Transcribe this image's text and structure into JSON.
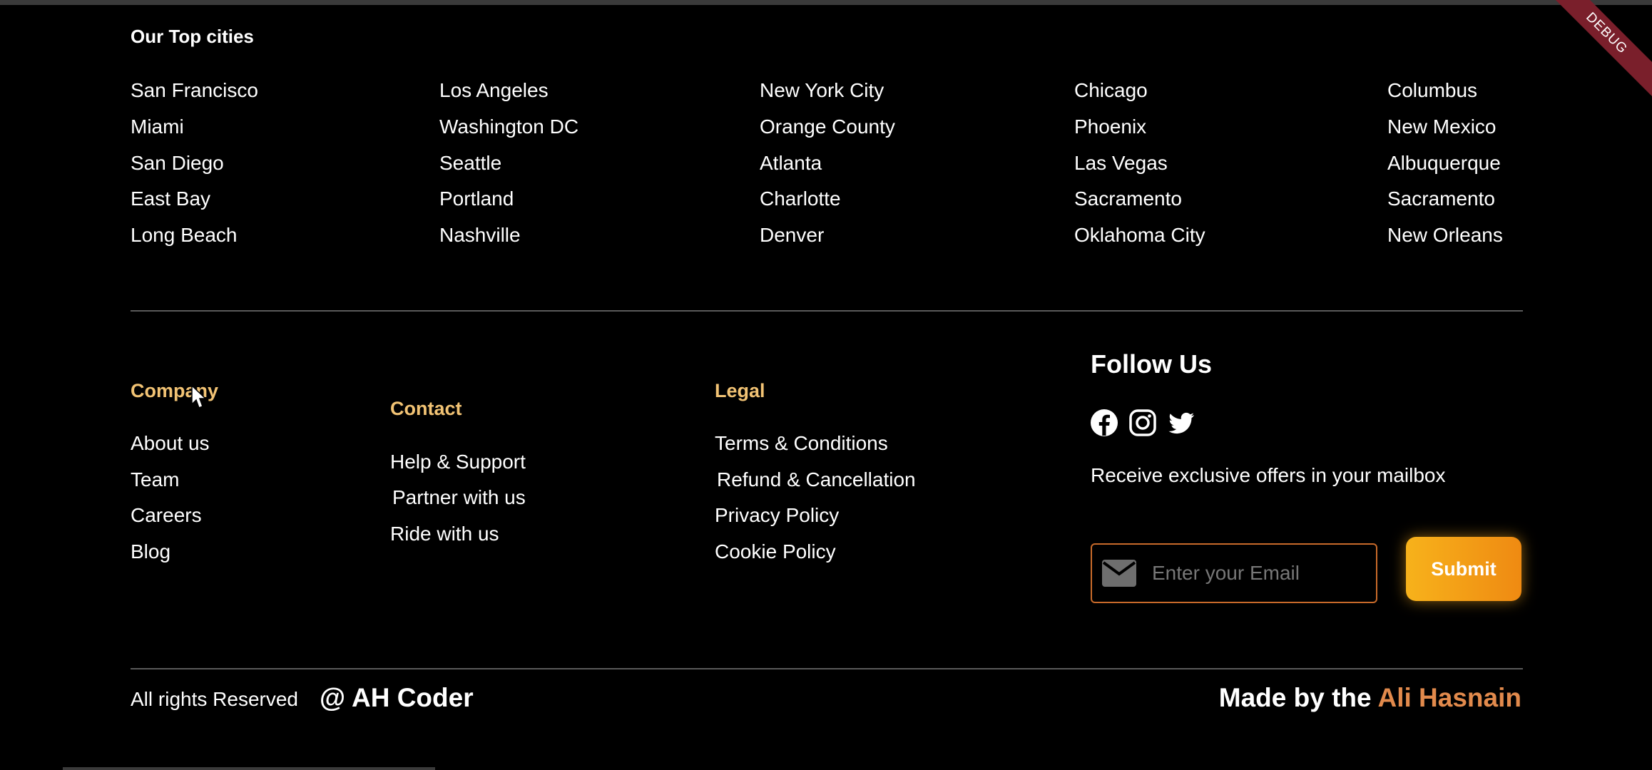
{
  "debug_banner": "DEBUG",
  "top_cities": {
    "title": "Our Top cities",
    "columns": [
      [
        "San Francisco",
        "Miami",
        "San Diego",
        "East Bay",
        "Long Beach"
      ],
      [
        "Los Angeles",
        "Washington DC",
        "Seattle",
        "Portland",
        "Nashville"
      ],
      [
        "New York City",
        "Orange County",
        "Atlanta",
        "Charlotte",
        "Denver"
      ],
      [
        "Chicago",
        "Phoenix",
        "Las Vegas",
        "Sacramento",
        "Oklahoma City"
      ],
      [
        "Columbus",
        "New Mexico",
        "Albuquerque",
        "Sacramento",
        "New Orleans"
      ]
    ]
  },
  "company": {
    "title": "Company",
    "links": [
      "About us",
      "Team",
      "Careers",
      "Blog"
    ]
  },
  "contact": {
    "title": "Contact",
    "links": [
      "Help & Support",
      "Partner with us",
      "Ride with us"
    ]
  },
  "legal": {
    "title": "Legal",
    "links": [
      "Terms & Conditions",
      "Refund & Cancellation",
      "Privacy Policy",
      "Cookie Policy"
    ]
  },
  "follow": {
    "title": "Follow Us",
    "icons": [
      "facebook-icon",
      "instagram-icon",
      "twitter-icon"
    ],
    "offers_text": "Receive exclusive offers in your mailbox",
    "email_placeholder": "Enter your Email",
    "submit_label": "Submit"
  },
  "footer": {
    "rights": "All rights Reserved",
    "brand": "@ AH Coder",
    "made_by_prefix": "Made by the",
    "made_by_name": "Ali Hasnain"
  },
  "colors": {
    "background": "#000000",
    "section_title": "#f2c374",
    "accent_orange": "#e28a4c",
    "submit_gradient_start": "#f7b21b",
    "submit_gradient_end": "#ef8a12",
    "email_border": "#c86a2a"
  }
}
